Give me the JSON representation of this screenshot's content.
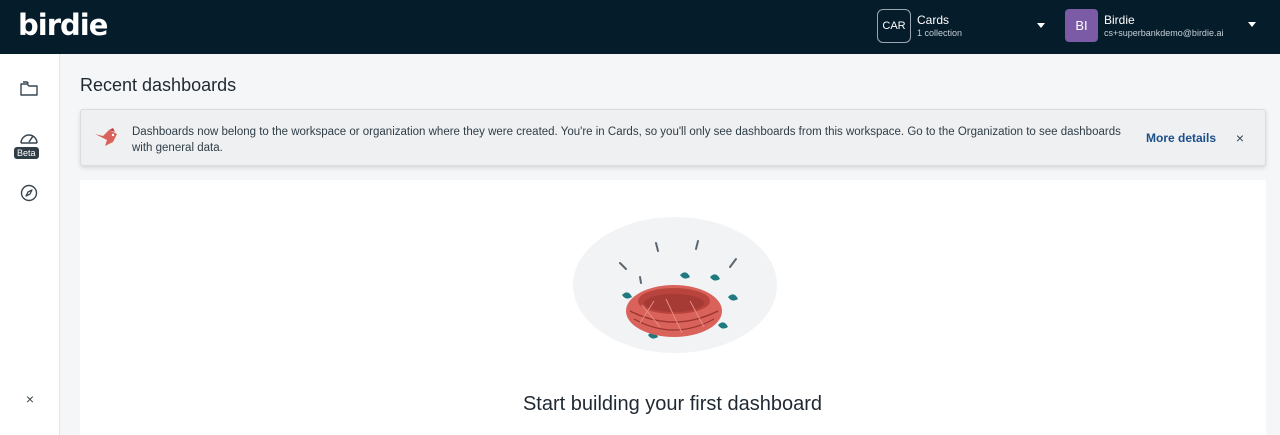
{
  "app": {
    "logo_text": "birdie"
  },
  "header": {
    "workspace": {
      "badge": "CAR",
      "name": "Cards",
      "subtitle": "1 collection"
    },
    "user": {
      "initials": "BI",
      "name": "Birdie",
      "email": "cs+superbankdemo@birdie.ai"
    }
  },
  "sidebar": {
    "items": [
      {
        "name": "collections",
        "icon": "folder-icon"
      },
      {
        "name": "dashboards",
        "icon": "gauge-icon",
        "badge": "Beta"
      },
      {
        "name": "explore",
        "icon": "compass-icon"
      }
    ],
    "collapse_icon": "close-icon",
    "collapse_label": "×"
  },
  "main": {
    "title": "Recent dashboards",
    "banner": {
      "icon": "birdie-bird-icon",
      "text": "Dashboards now belong to the workspace or organization where they were created. You're in Cards, so you'll only see dashboards from this workspace. Go to the Organization to see dashboards with general data.",
      "link": "More details",
      "close_label": "×"
    },
    "empty_state": {
      "illustration": "empty-nest-illustration",
      "title": "Start building your first dashboard"
    }
  },
  "colors": {
    "topbar": "#051c2a",
    "avatar": "#7b5aa6",
    "nest": "#d9625a",
    "leaf": "#1f7a80",
    "link": "#1b4f8a"
  }
}
